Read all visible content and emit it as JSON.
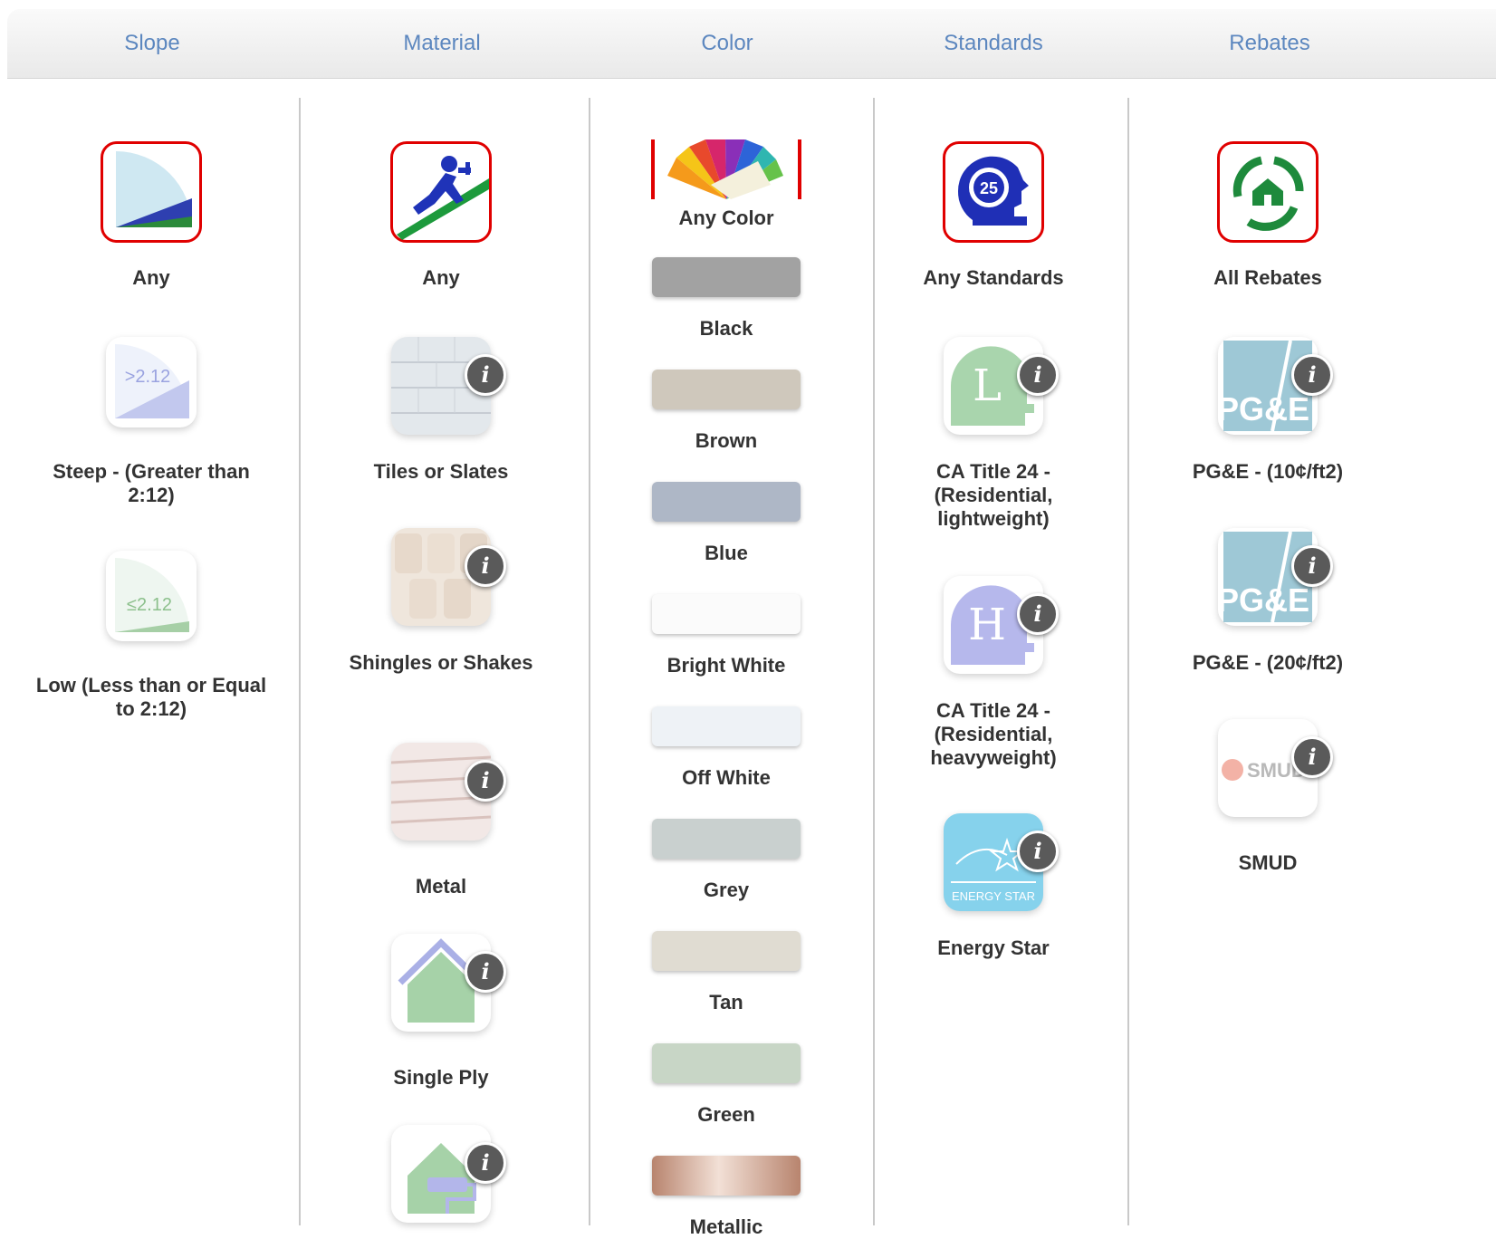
{
  "tabs": [
    "Slope",
    "Material",
    "Color",
    "Standards",
    "Rebates"
  ],
  "slope": {
    "items": [
      {
        "label": "Any",
        "badge": ""
      },
      {
        "label": "Steep - (Greater than 2:12)",
        "badge": ">2.12"
      },
      {
        "label": "Low (Less than or Equal to 2:12)",
        "badge": "≤2.12"
      }
    ]
  },
  "material": {
    "items": [
      {
        "label": "Any"
      },
      {
        "label": "Tiles or Slates"
      },
      {
        "label": "Shingles or Shakes"
      },
      {
        "label": "Metal"
      },
      {
        "label": "Single Ply"
      }
    ]
  },
  "color": {
    "any_label": "Any Color",
    "swatches": [
      {
        "label": "Black",
        "color": "#a2a2a2"
      },
      {
        "label": "Brown",
        "color": "#cfc8bc"
      },
      {
        "label": "Blue",
        "color": "#aeb7c6"
      },
      {
        "label": "Bright White",
        "color": "#fbfbfb"
      },
      {
        "label": "Off White",
        "color": "#eef2f6"
      },
      {
        "label": "Grey",
        "color": "#c9d0cf"
      },
      {
        "label": "Tan",
        "color": "#e0dcd2"
      },
      {
        "label": "Green",
        "color": "#c8d6c6"
      },
      {
        "label": "Metallic",
        "color": "#c9a08e"
      }
    ]
  },
  "standards": {
    "items": [
      {
        "label": "Any Standards",
        "badge": "25"
      },
      {
        "label": "CA Title 24 - (Residential, lightweight)",
        "badge": "L"
      },
      {
        "label": "CA Title 24 - (Residential, heavyweight)",
        "badge": "H"
      },
      {
        "label": "Energy Star",
        "badge": "ENERGY STAR"
      }
    ]
  },
  "rebates": {
    "items": [
      {
        "label": "All Rebates"
      },
      {
        "label": "PG&E - (10¢/ft2)",
        "badge": "PG&E"
      },
      {
        "label": "PG&E - (20¢/ft2)",
        "badge": "PG&E"
      },
      {
        "label": "SMUD",
        "badge": "SMUD"
      }
    ]
  },
  "info_glyph": "i",
  "colors": {
    "accent_blue": "#5c87bf",
    "selected_border": "#e00000"
  }
}
